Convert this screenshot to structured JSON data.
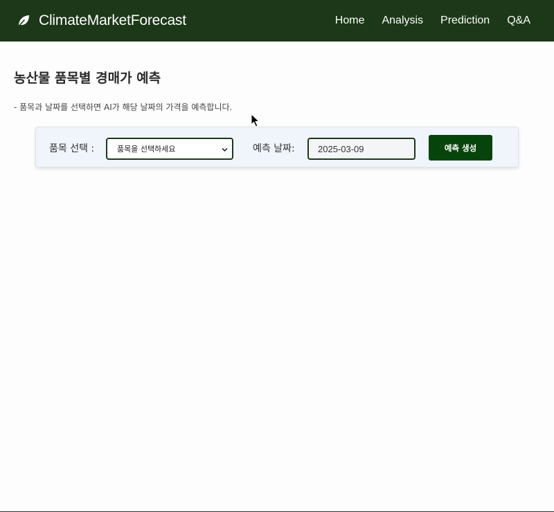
{
  "navbar": {
    "brand": "ClimateMarketForecast",
    "brand_icon": "leaf-icon",
    "links": [
      "Home",
      "Analysis",
      "Prediction",
      "Q&A"
    ],
    "background": "#1c3818"
  },
  "main": {
    "title": "농산물 품목별 경매가 예측",
    "description": "- 품목과 날짜를 선택하면 AI가 해당 날짜의 가격을 예측합니다."
  },
  "form": {
    "item_label": "품목 선택 :",
    "item_select_value": "품목을 선택하세요",
    "date_label": "예측 날짜:",
    "date_value": "2025-03-09",
    "submit_label": "예측 생성",
    "button_color": "#07440b"
  }
}
